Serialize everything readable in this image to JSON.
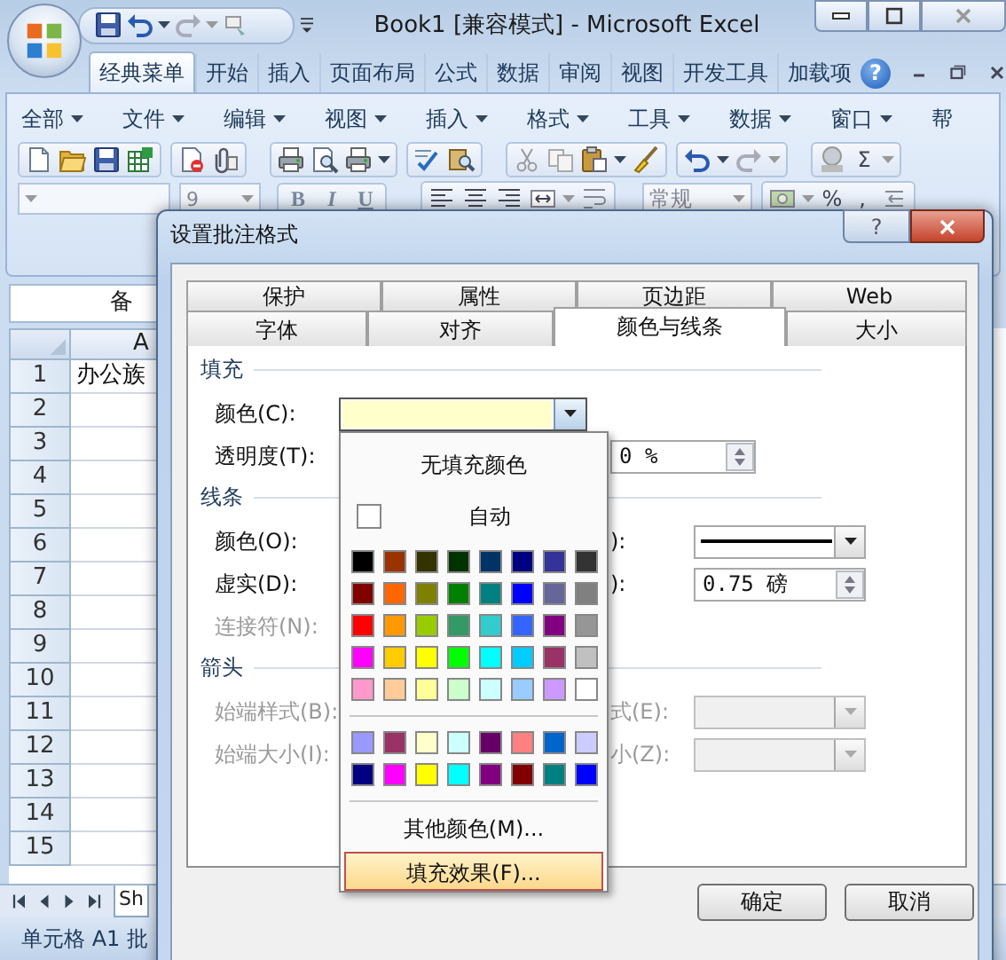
{
  "window": {
    "title": "Book1  [兼容模式] - Microsoft Excel"
  },
  "ribbon_tabs": [
    {
      "label": "经典菜单",
      "selected": true
    },
    {
      "label": "开始",
      "selected": false
    },
    {
      "label": "插入",
      "selected": false
    },
    {
      "label": "页面布局",
      "selected": false
    },
    {
      "label": "公式",
      "selected": false
    },
    {
      "label": "数据",
      "selected": false
    },
    {
      "label": "审阅",
      "selected": false
    },
    {
      "label": "视图",
      "selected": false
    },
    {
      "label": "开发工具",
      "selected": false
    },
    {
      "label": "加载项",
      "selected": false
    }
  ],
  "ribbon_help": "?",
  "menu_bar": [
    {
      "label": "全部",
      "dropdown": true
    },
    {
      "label": "文件",
      "dropdown": true
    },
    {
      "label": "编辑",
      "dropdown": true
    },
    {
      "label": "视图",
      "dropdown": true
    },
    {
      "label": "插入",
      "dropdown": true
    },
    {
      "label": "格式",
      "dropdown": true
    },
    {
      "label": "工具",
      "dropdown": true
    },
    {
      "label": "数据",
      "dropdown": true
    },
    {
      "label": "窗口",
      "dropdown": true
    },
    {
      "label": "帮",
      "dropdown": false
    }
  ],
  "toolbar": {
    "font_size": "9",
    "bold": "B",
    "italic": "I",
    "underline": "U",
    "number_format": "常规",
    "sum": "Σ",
    "percent": "%",
    "comma": ","
  },
  "name_box": "备",
  "column_headers": [
    "A"
  ],
  "rows": [
    {
      "header": "1",
      "cell_a": "办公族"
    },
    {
      "header": "2"
    },
    {
      "header": "3"
    },
    {
      "header": "4"
    },
    {
      "header": "5"
    },
    {
      "header": "6"
    },
    {
      "header": "7"
    },
    {
      "header": "8"
    },
    {
      "header": "9"
    },
    {
      "header": "10"
    },
    {
      "header": "11"
    },
    {
      "header": "12"
    },
    {
      "header": "13"
    },
    {
      "header": "14"
    },
    {
      "header": "15"
    }
  ],
  "sheet_tab": "Sh",
  "status_bar": "单元格 A1 批",
  "dialog": {
    "title": "设置批注格式",
    "help": "?",
    "tab_rows": [
      [
        {
          "label": "保护",
          "selected": false
        },
        {
          "label": "属性",
          "selected": false
        },
        {
          "label": "页边距",
          "selected": false
        },
        {
          "label": "Web",
          "selected": false
        }
      ],
      [
        {
          "label": "字体",
          "selected": false
        },
        {
          "label": "对齐",
          "selected": false
        },
        {
          "label": "颜色与线条",
          "selected": true
        },
        {
          "label": "大小",
          "selected": false
        }
      ]
    ],
    "fill": {
      "heading": "填充",
      "color_label": "颜色(C):",
      "color": "#ffffcc",
      "transparency_label": "透明度(T):",
      "transparency": "0 %"
    },
    "line": {
      "heading": "线条",
      "color_label": "颜色(O):",
      "style_label": "):",
      "dash_label": "虚实(D):",
      "weight_label": "):",
      "weight": "0.75 磅",
      "connector_label": "连接符(N):",
      "connector_disabled": true
    },
    "arrows": {
      "heading": "箭头",
      "begin_style_label": "始端样式(B):",
      "end_style_label": "式(E):",
      "begin_size_label": "始端大小(I):",
      "end_size_label": "小(Z):",
      "disabled": true
    },
    "buttons": [
      "确定",
      "取消"
    ],
    "color_menu": {
      "no_fill": "无填充颜色",
      "automatic": "自动",
      "swatches": [
        {
          "color": "#000000"
        },
        {
          "color": "#993300"
        },
        {
          "color": "#333300"
        },
        {
          "color": "#003300"
        },
        {
          "color": "#003366"
        },
        {
          "color": "#000080"
        },
        {
          "color": "#333399"
        },
        {
          "color": "#333333"
        },
        {
          "color": "#800000"
        },
        {
          "color": "#ff6600"
        },
        {
          "color": "#808000"
        },
        {
          "color": "#008000"
        },
        {
          "color": "#008080"
        },
        {
          "color": "#0000ff"
        },
        {
          "color": "#666699"
        },
        {
          "color": "#808080"
        },
        {
          "color": "#ff0000"
        },
        {
          "color": "#ff9900"
        },
        {
          "color": "#99cc00"
        },
        {
          "color": "#339966"
        },
        {
          "color": "#33cccc"
        },
        {
          "color": "#3366ff"
        },
        {
          "color": "#800080"
        },
        {
          "color": "#969696"
        },
        {
          "color": "#ff00ff"
        },
        {
          "color": "#ffcc00"
        },
        {
          "color": "#ffff00"
        },
        {
          "color": "#00ff00"
        },
        {
          "color": "#00ffff"
        },
        {
          "color": "#00ccff"
        },
        {
          "color": "#993366"
        },
        {
          "color": "#c0c0c0"
        },
        {
          "color": "#ff99cc"
        },
        {
          "color": "#ffcc99"
        },
        {
          "color": "#ffff99"
        },
        {
          "color": "#ccffcc"
        },
        {
          "color": "#ccffff"
        },
        {
          "color": "#99ccff"
        },
        {
          "color": "#cc99ff"
        },
        {
          "color": "#ffffff"
        }
      ],
      "extra_swatches": [
        {
          "color": "#9999ff"
        },
        {
          "color": "#993366"
        },
        {
          "color": "#ffffcc"
        },
        {
          "color": "#ccffff"
        },
        {
          "color": "#660066"
        },
        {
          "color": "#ff8080"
        },
        {
          "color": "#0066cc"
        },
        {
          "color": "#ccccff"
        },
        {
          "color": "#000080"
        },
        {
          "color": "#ff00ff"
        },
        {
          "color": "#ffff00"
        },
        {
          "color": "#00ffff"
        },
        {
          "color": "#800080"
        },
        {
          "color": "#800000"
        },
        {
          "color": "#008080"
        },
        {
          "color": "#0000ff"
        }
      ],
      "items": [
        {
          "label": "其他颜色(M)...",
          "selected": false
        },
        {
          "label": "填充效果(F)...",
          "selected": true
        }
      ]
    }
  }
}
